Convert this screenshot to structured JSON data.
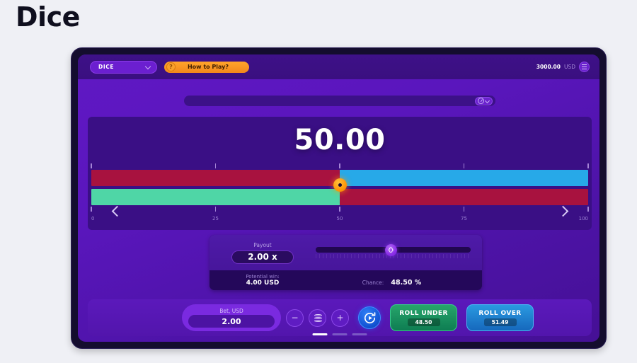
{
  "page": {
    "title": "Dice"
  },
  "topbar": {
    "game_select": {
      "label": "DICE",
      "icon": "chevron-down-icon"
    },
    "how_to_play": {
      "label": "How to Play?",
      "icon": "question-mark-icon"
    },
    "balance": {
      "amount": "3000.00",
      "currency": "USD"
    },
    "menu": {
      "icon": "hamburger-menu-icon"
    }
  },
  "history": {
    "gauge_icon": "gauge-icon",
    "chevron_icon": "chevron-down-icon"
  },
  "board": {
    "big_number": "50.00",
    "handle_value": 50,
    "axis_labels": [
      "0",
      "25",
      "50",
      "75",
      "100"
    ],
    "axis_values": [
      0,
      25,
      50,
      75,
      100
    ],
    "nav_left_icon": "chevron-left-icon",
    "nav_right_icon": "chevron-right-icon",
    "bars": [
      {
        "name": "roll-over-bar",
        "left_color": "#a8123f",
        "right_color": "#27a9e8",
        "split": 50
      },
      {
        "name": "roll-under-bar",
        "left_color": "#4fd6a6",
        "right_color": "#a8123f",
        "split": 50
      }
    ]
  },
  "payout": {
    "label": "Payout",
    "value": "2.00 x",
    "slider_position": 48.5,
    "slider_handle_icon": "left-right-arrows-icon",
    "potential_win_label": "Potential win:",
    "potential_win_value": "4.00 USD",
    "chance_label": "Chance:",
    "chance_value": "48.50 %"
  },
  "controls": {
    "bet_label": "Bet, USD",
    "bet_value": "2.00",
    "minus_label": "−",
    "plus_label": "+",
    "coins_icon": "coins-stack-icon",
    "auto_icon": "auto-play-icon",
    "roll_under": {
      "label": "ROLL UNDER",
      "value": "48.50"
    },
    "roll_over": {
      "label": "ROLL OVER",
      "value": "51.49"
    }
  },
  "indicators": {
    "count": 3,
    "active": 0
  },
  "colors": {
    "accent_orange": "#ff9a0c",
    "panel_purple": "#5a16bd",
    "board_purple": "#3a0f85",
    "green": "#0e7d52",
    "blue": "#1668bd",
    "red": "#a8123f",
    "mint": "#4fd6a6",
    "cyan": "#27a9e8"
  }
}
